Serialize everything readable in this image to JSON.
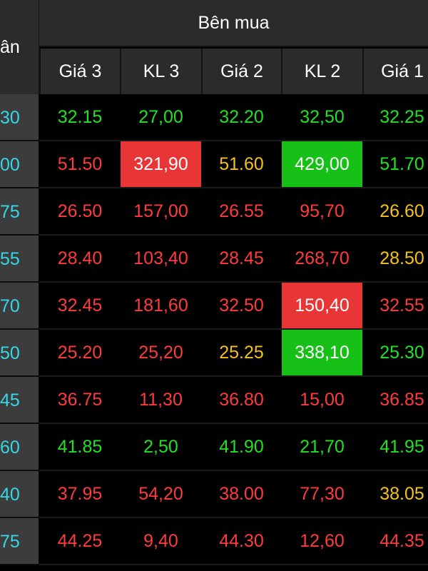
{
  "header": {
    "left_fragment": "ân",
    "group_title": "Bên mua",
    "columns": [
      "Giá 3",
      "KL 3",
      "Giá 2",
      "KL 2",
      "Giá 1"
    ]
  },
  "rows": [
    {
      "ref": "30",
      "values": [
        "32.15",
        "27,00",
        "32.20",
        "32,50",
        "32.25"
      ],
      "colors": [
        "green",
        "green",
        "green",
        "green",
        "green"
      ]
    },
    {
      "ref": "00",
      "values": [
        "51.50",
        "321,90",
        "51.60",
        "429,00",
        "51.70"
      ],
      "colors": [
        "red",
        "hl-red",
        "yellow",
        "hl-green",
        "green"
      ]
    },
    {
      "ref": "75",
      "values": [
        "26.50",
        "157,00",
        "26.55",
        "95,70",
        "26.60"
      ],
      "colors": [
        "red",
        "red",
        "red",
        "red",
        "yellow"
      ]
    },
    {
      "ref": "55",
      "values": [
        "28.40",
        "103,40",
        "28.45",
        "268,70",
        "28.50"
      ],
      "colors": [
        "red",
        "red",
        "red",
        "red",
        "yellow"
      ]
    },
    {
      "ref": "70",
      "values": [
        "32.45",
        "181,60",
        "32.50",
        "150,40",
        "32.55"
      ],
      "colors": [
        "red",
        "red",
        "red",
        "hl-red",
        "red"
      ]
    },
    {
      "ref": "50",
      "values": [
        "25.20",
        "25,20",
        "25.25",
        "338,10",
        "25.30"
      ],
      "colors": [
        "red",
        "red",
        "yellow",
        "hl-green",
        "green"
      ]
    },
    {
      "ref": "45",
      "values": [
        "36.75",
        "11,30",
        "36.80",
        "15,00",
        "36.85"
      ],
      "colors": [
        "red",
        "red",
        "red",
        "red",
        "red"
      ]
    },
    {
      "ref": "60",
      "values": [
        "41.85",
        "2,50",
        "41.90",
        "21,70",
        "41.95"
      ],
      "colors": [
        "green",
        "green",
        "green",
        "green",
        "green"
      ]
    },
    {
      "ref": "40",
      "values": [
        "37.95",
        "54,20",
        "38.00",
        "77,30",
        "38.05"
      ],
      "colors": [
        "red",
        "red",
        "red",
        "red",
        "yellow"
      ]
    },
    {
      "ref": "75",
      "values": [
        "44.25",
        "9,40",
        "44.30",
        "12,60",
        "44.35"
      ],
      "colors": [
        "red",
        "red",
        "red",
        "red",
        "red"
      ]
    }
  ]
}
